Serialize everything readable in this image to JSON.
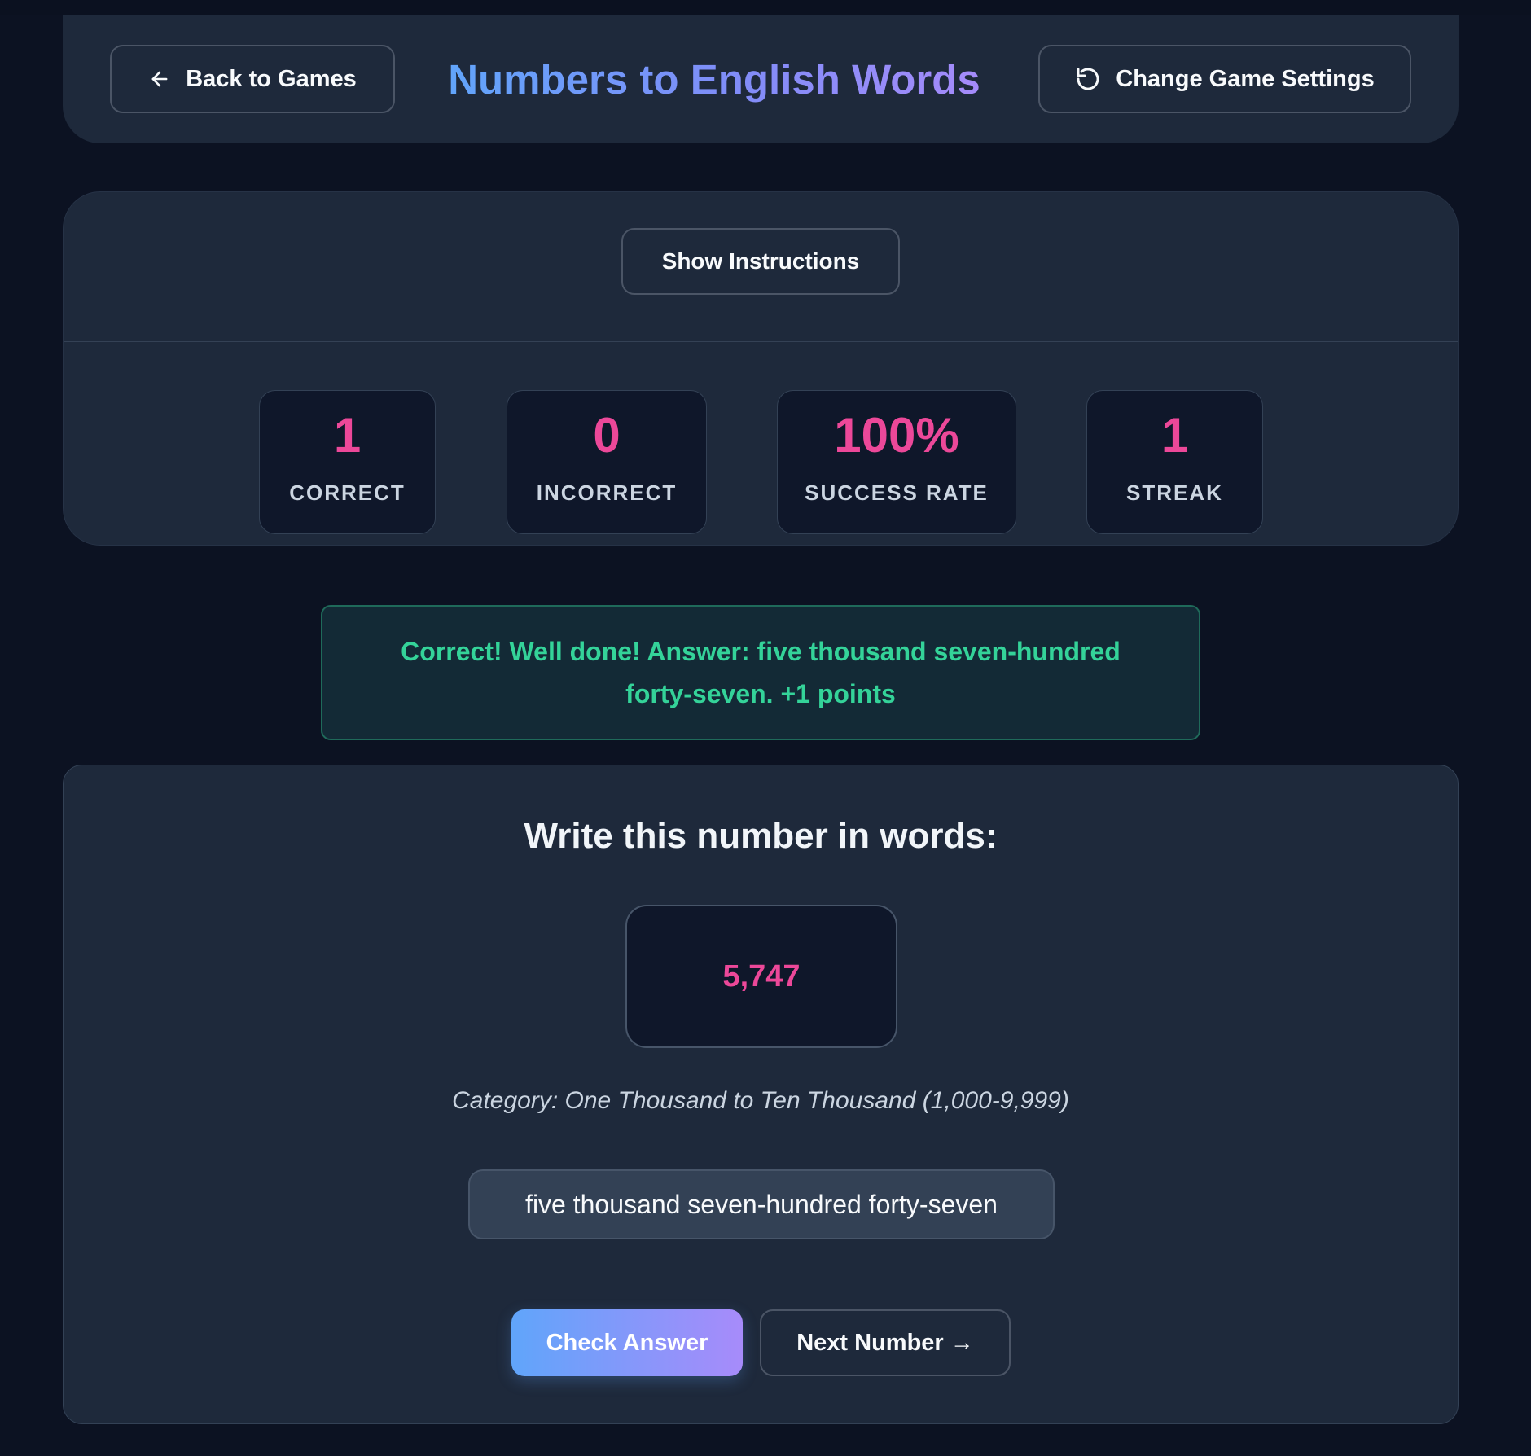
{
  "header": {
    "back_label": "Back to Games",
    "title": "Numbers to English Words",
    "settings_label": "Change Game Settings",
    "back_icon": "arrow-left-icon",
    "settings_icon": "refresh-icon"
  },
  "instructions": {
    "toggle_label": "Show Instructions"
  },
  "stats": [
    {
      "value": "1",
      "label": "CORRECT"
    },
    {
      "value": "0",
      "label": "INCORRECT"
    },
    {
      "value": "100%",
      "label": "SUCCESS RATE"
    },
    {
      "value": "1",
      "label": "STREAK"
    }
  ],
  "feedback": {
    "prefix": "Correct! Well done!",
    "answer_label": "Answer:",
    "answer_text": "five thousand seven-hundred forty-seven. +1 points"
  },
  "question": {
    "heading": "Write this number in words:",
    "number": "5,747",
    "category": "Category: One Thousand to Ten Thousand (1,000-9,999)",
    "answer_value": "five thousand seven-hundred forty-seven",
    "check_label": "Check Answer",
    "next_label": "Next Number →"
  },
  "colors": {
    "background": "#0c1222",
    "card": "#1e293b",
    "accent_pink": "#ec4899",
    "success_green": "#34d399",
    "gradient_start": "#60a5fa",
    "gradient_end": "#a78bfa"
  }
}
